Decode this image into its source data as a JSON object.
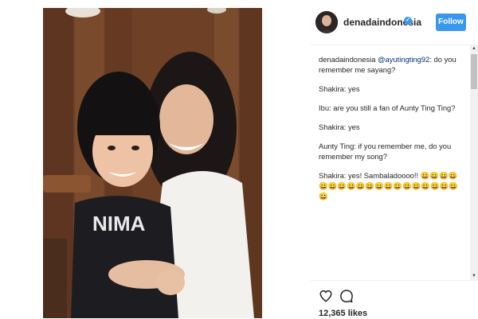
{
  "post": {
    "username": "denadaindonesia",
    "follow_label": "Follow",
    "likes": "12,365 likes"
  },
  "icons": {
    "verified": "verified-badge-icon",
    "like": "heart-icon",
    "comment": "comment-icon"
  },
  "colors": {
    "accent": "#3897f0",
    "text": "#262626",
    "mention": "#003569"
  },
  "caption": {
    "lines": [
      {
        "user": "denadaindonesia",
        "mention": "@ayutingting92",
        "text": ": do you remember me sayang?"
      },
      {
        "text": "Shakira: yes"
      },
      {
        "text": "Ibu: are you still a fan of Aunty Ting Ting?"
      },
      {
        "text": "Shakira: yes"
      },
      {
        "text": "Aunty Ting: if you remember me, do you remember my song?"
      },
      {
        "text": "Shakira: yes! Sambaladoooo!! 😀😀😀😀😀😀😀😀😀😀😀😀😀😀😀😀😀😀😀😀"
      }
    ]
  }
}
